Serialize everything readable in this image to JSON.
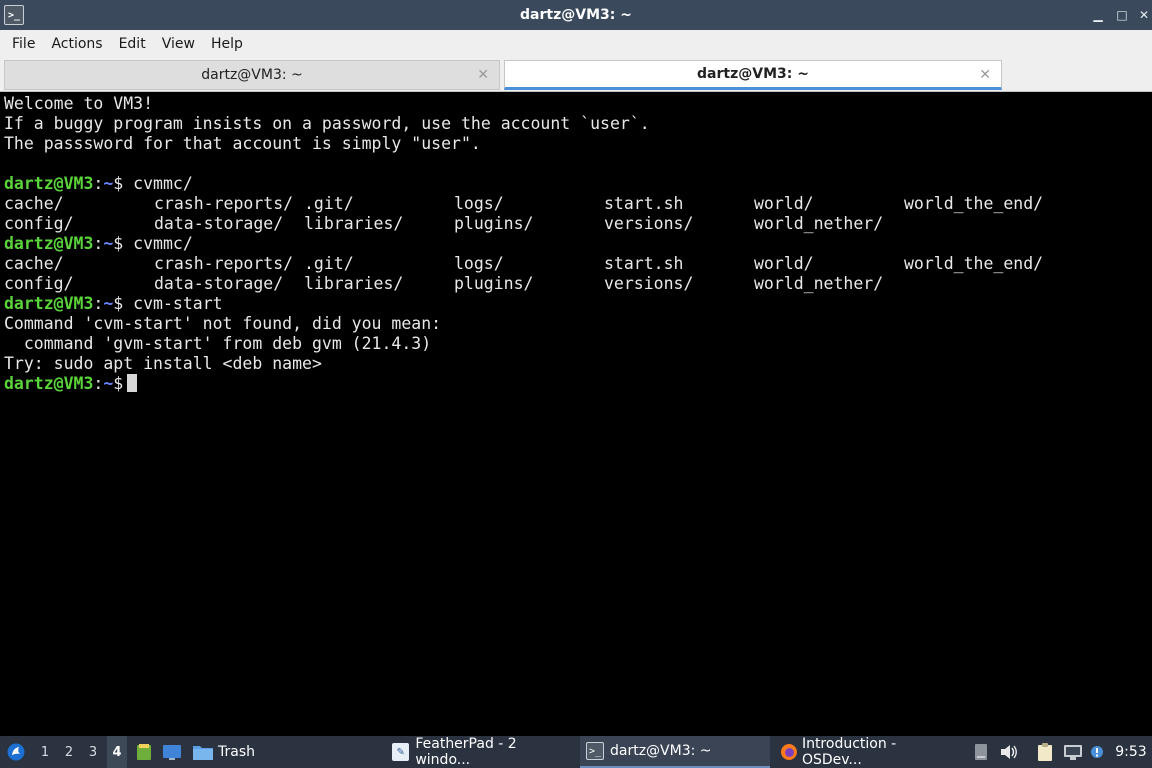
{
  "window": {
    "title": "dartz@VM3: ~",
    "controls": {
      "minimize": "▁",
      "maximize": "□",
      "close": "✕"
    }
  },
  "menubar": {
    "items": [
      "File",
      "Actions",
      "Edit",
      "View",
      "Help"
    ]
  },
  "tabs": [
    {
      "label": "dartz@VM3: ~",
      "close": "✕",
      "active": false
    },
    {
      "label": "dartz@VM3: ~",
      "close": "✕",
      "active": true
    }
  ],
  "terminal": {
    "welcome": [
      "Welcome to VM3!",
      "If a buggy program insists on a password, use the account `user`.",
      "The passsword for that account is simply \"user\"."
    ],
    "prompt": {
      "user": "dartz@VM3",
      "sep": ":",
      "dir": "~",
      "symbol": "$"
    },
    "cmd1": " cvmmc/",
    "ls_row1": [
      "cache/",
      "crash-reports/",
      ".git/",
      "logs/",
      "start.sh",
      "world/",
      "world_the_end/"
    ],
    "ls_row2": [
      "config/",
      "data-storage/",
      "libraries/",
      "plugins/",
      "versions/",
      "world_nether/"
    ],
    "cmd2": " cvmmc/",
    "cmd3": " cvm-start",
    "error": [
      "Command 'cvm-start' not found, did you mean:",
      "  command 'gvm-start' from deb gvm (21.4.3)",
      "Try: sudo apt install <deb name>"
    ]
  },
  "taskbar": {
    "desktops": [
      "1",
      "2",
      "3",
      "4"
    ],
    "active_desktop": "4",
    "trash_label": "Trash",
    "tasks": [
      {
        "label": "FeatherPad - 2 windo...",
        "icon": "featherpad-icon"
      },
      {
        "label": "dartz@VM3: ~",
        "icon": "terminal-icon",
        "active": true
      },
      {
        "label": "Introduction - OSDev...",
        "icon": "firefox-icon"
      }
    ],
    "clock": "9:53"
  },
  "colors": {
    "titlebar_bg": "#3a4a5c",
    "prompt_user": "#5bd33a",
    "prompt_dir": "#6a86ff",
    "taskbar_bg": "#2b3340",
    "tab_accent": "#4a90d9"
  }
}
